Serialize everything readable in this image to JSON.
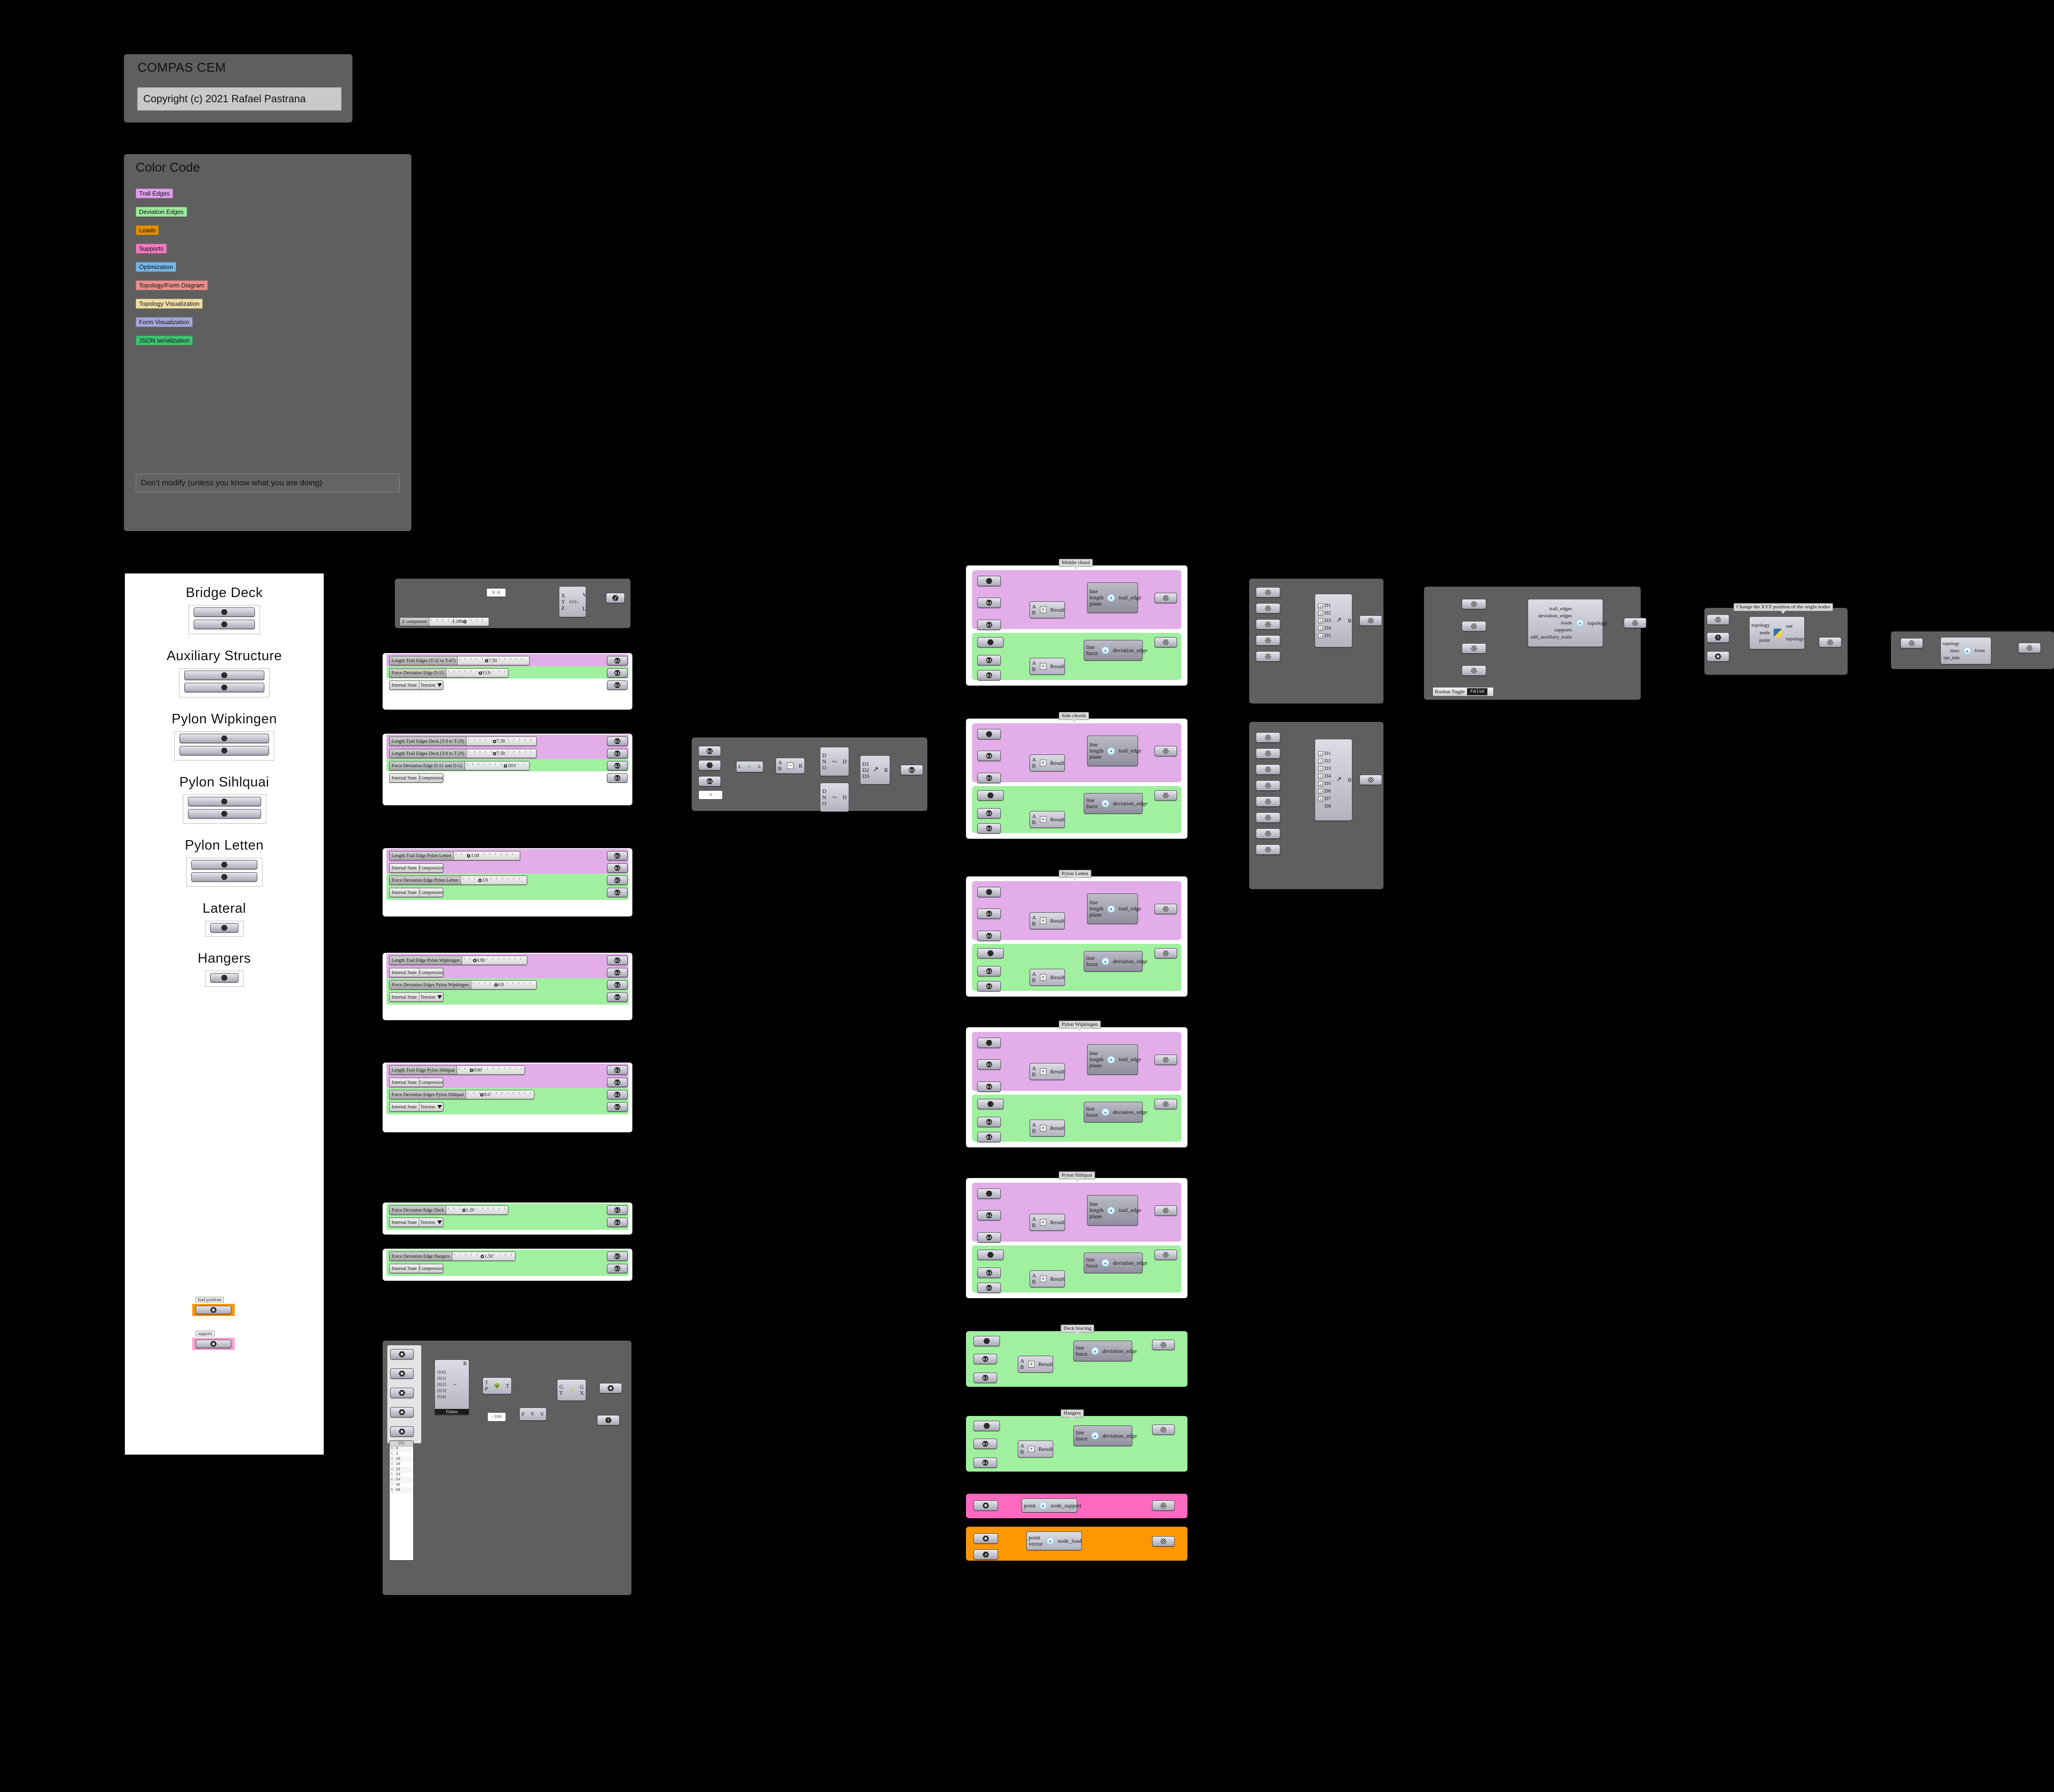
{
  "header": {
    "title": "COMPAS CEM",
    "copyright": "Copyright (c) 2021 Rafael Pastrana"
  },
  "color_code": {
    "title": "Color Code",
    "note": "Don’t modify (unless you know what you are doing)",
    "items": [
      {
        "label": "Trail Edges",
        "color": "#dda0e8"
      },
      {
        "label": "Deviation Edges",
        "color": "#9ce89c"
      },
      {
        "label": "Loads",
        "color": "#e09000"
      },
      {
        "label": "Supports",
        "color": "#f07ac0"
      },
      {
        "label": "Optimization",
        "color": "#74b6e8"
      },
      {
        "label": "Topology/Form Diagram",
        "color": "#e8908c"
      },
      {
        "label": "Topology Visualization",
        "color": "#eedfa5"
      },
      {
        "label": "Form Visualization",
        "color": "#a5a5d8"
      },
      {
        "label": "JSON serialization",
        "color": "#40c070"
      }
    ]
  },
  "structure_panel": {
    "sections": [
      {
        "title": "Bridge Deck",
        "params": 2
      },
      {
        "title": "Auxiliary Structure",
        "params": 2
      },
      {
        "title": "Pylon Wipkingen",
        "params": 2
      },
      {
        "title": "Pylon Sihlquai",
        "params": 2
      },
      {
        "title": "Pylon Letten",
        "params": 2
      },
      {
        "title": "Lateral",
        "params": 1
      },
      {
        "title": "Hangers",
        "params": 1
      }
    ],
    "tagged": [
      {
        "label": "load positions",
        "color": "#ff9800"
      },
      {
        "label": "supports",
        "color": "#ff9fd4"
      }
    ]
  },
  "vector_cluster": {
    "panel_value": "0.0",
    "slider": {
      "name": "Z component",
      "value": "-1.500"
    },
    "component": {
      "inputs": [
        "X",
        "Y",
        "Z"
      ],
      "outputs": [
        "V",
        "L"
      ],
      "icon": "xyz-vector-icon"
    }
  },
  "slider_groups": [
    {
      "rows": [
        {
          "band": "purple",
          "type": "slider",
          "name": "Length Trail Edges  (T-32 to T-47)",
          "value": "7.50",
          "knob": 0.42
        },
        {
          "band": "green",
          "type": "slider",
          "name": "Force Deviation Edge D-53",
          "value": "15.0",
          "knob": 0.72
        },
        {
          "band": "none",
          "type": "vlist",
          "name": "Internal State",
          "value": "Tension"
        }
      ]
    },
    {
      "rows": [
        {
          "band": "purple",
          "type": "slider",
          "name": "Length Trail Edges Deck (T-0 to T-29)",
          "value": "7.50",
          "knob": 0.42
        },
        {
          "band": "purple",
          "type": "slider",
          "name": "Length Trail Edges Deck (T-0 to T-29)",
          "value": "7.50",
          "knob": 0.42
        },
        {
          "band": "green",
          "type": "slider",
          "name": "Force Deviation Edge D-51 and D-52",
          "value": "20.0",
          "knob": 0.88
        },
        {
          "band": "none",
          "type": "vlist",
          "name": "Internal State",
          "value": "Compression"
        }
      ]
    },
    {
      "rows": [
        {
          "band": "purple",
          "type": "slider",
          "name": "Length Trail Edge Pylon Letten",
          "value": "1.00",
          "knob": 0.08
        },
        {
          "band": "purple",
          "type": "vlist",
          "name": "Internal State",
          "value": "Compression"
        },
        {
          "band": "green",
          "type": "slider",
          "name": "Force Deviation Edge Pylon Letten",
          "value": "3.0",
          "knob": 0.17
        },
        {
          "band": "green",
          "type": "vlist",
          "name": "Internal State",
          "value": "Compression"
        }
      ]
    },
    {
      "rows": [
        {
          "band": "purple",
          "type": "slider",
          "name": "Length Trail Edge Pylon Wipkingen",
          "value": "0.00",
          "knob": 0.02
        },
        {
          "band": "purple",
          "type": "vlist",
          "name": "Internal State",
          "value": "Compression"
        },
        {
          "band": "green",
          "type": "slider",
          "name": "Force Deviation Edges Pylon Wipkingen",
          "value": "0.0",
          "knob": 0.35
        },
        {
          "band": "green",
          "type": "vlist",
          "name": "Internal State",
          "value": "Tension"
        }
      ]
    },
    {
      "rows": [
        {
          "band": "purple",
          "type": "slider",
          "name": "Length Trail Edge Pylon Sihlquai",
          "value": "0.00",
          "knob": 0.03
        },
        {
          "band": "purple",
          "type": "vlist",
          "name": "Internal State",
          "value": "Compression"
        },
        {
          "band": "green",
          "type": "slider",
          "name": "Force Deviation Edges Pylon Sihlquai",
          "value": "0.0",
          "knob": 0.04
        },
        {
          "band": "green",
          "type": "vlist",
          "name": "Internal State",
          "value": "Tension"
        }
      ]
    },
    {
      "rows": [
        {
          "band": "green",
          "type": "slider",
          "name": "Force Deviation Edge Deck",
          "value": "1.20",
          "knob": 0.22
        },
        {
          "band": "green",
          "type": "vlist",
          "name": "Internal State",
          "value": "Tension"
        }
      ]
    },
    {
      "rows": [
        {
          "band": "green",
          "type": "slider",
          "name": "Force Deviation Edge Hangers",
          "value": "1.30",
          "knob": 0.59
        },
        {
          "band": "green",
          "type": "vlist",
          "name": "Internal State",
          "value": "Compression"
        }
      ]
    }
  ],
  "edge_clusters": [
    {
      "label": "Middle chord",
      "trail": {
        "icon": "cem-icon",
        "inputs": [
          "line",
          "length",
          "plane"
        ],
        "output": "trail_edge"
      },
      "deviation": {
        "icon": "cem-icon",
        "inputs": [
          "line",
          "force"
        ],
        "output": "deviation_edge"
      },
      "math": {
        "a": "A",
        "b": "B",
        "op": "×",
        "result": "Result"
      }
    },
    {
      "label": "Side chords",
      "trail": {
        "icon": "cem-icon",
        "inputs": [
          "line",
          "length",
          "plane"
        ],
        "output": "trail_edge"
      },
      "deviation": {
        "icon": "cem-icon",
        "inputs": [
          "line",
          "force"
        ],
        "output": "deviation_edge"
      },
      "math": {
        "a": "A",
        "b": "B",
        "op": "×",
        "result": "Result"
      }
    },
    {
      "label": "Pylon Letten",
      "trail": {
        "icon": "cem-icon",
        "inputs": [
          "line",
          "length",
          "plane"
        ],
        "output": "trail_edge"
      },
      "deviation": {
        "icon": "cem-icon",
        "inputs": [
          "line",
          "force"
        ],
        "output": "deviation_edge"
      },
      "math": {
        "a": "A",
        "b": "B",
        "op": "×",
        "result": "Result"
      }
    },
    {
      "label": "Pylon Wipkingen",
      "trail": {
        "icon": "cem-icon",
        "inputs": [
          "line",
          "length",
          "plane"
        ],
        "output": "trail_edge"
      },
      "deviation": {
        "icon": "cem-icon",
        "inputs": [
          "line",
          "force"
        ],
        "output": "deviation_edge"
      },
      "math": {
        "a": "A",
        "b": "B",
        "op": "×",
        "result": "Result"
      }
    },
    {
      "label": "Pylon Sihlquai",
      "trail": {
        "icon": "cem-icon",
        "inputs": [
          "line",
          "length",
          "plane"
        ],
        "output": "trail_edge"
      },
      "deviation": {
        "icon": "cem-icon",
        "inputs": [
          "line",
          "force"
        ],
        "output": "deviation_edge"
      },
      "math": {
        "a": "A",
        "b": "B",
        "op": "×",
        "result": "Result"
      }
    }
  ],
  "deck_bracing": {
    "label": "Deck bracing",
    "deviation": {
      "inputs": [
        "line",
        "force"
      ],
      "output": "deviation_edge"
    },
    "math": {
      "a": "A",
      "b": "B",
      "op": "×",
      "result": "Result"
    }
  },
  "hangers": {
    "label": "Hangers",
    "deviation": {
      "inputs": [
        "line",
        "force"
      ],
      "output": "deviation_edge"
    },
    "math": {
      "a": "A",
      "b": "B",
      "op": "×",
      "result": "Result"
    }
  },
  "supports_cluster": {
    "component": {
      "inputs": [
        "point"
      ],
      "output": "node_support"
    }
  },
  "loads_cluster": {
    "component": {
      "inputs": [
        "point",
        "vector"
      ],
      "output": "node_load"
    }
  },
  "merge_top": {
    "inputs": [
      "D1",
      "D2",
      "D3",
      "D4",
      "D5"
    ],
    "output": "R"
  },
  "merge_bottom": {
    "inputs": [
      "D1",
      "D2",
      "D3",
      "D4",
      "D5",
      "D6",
      "D7",
      "D8"
    ],
    "output": "R"
  },
  "topology_cluster": {
    "component": {
      "inputs": [
        "trail_edges",
        "deviation_edges",
        "loads",
        "supports",
        "add_auxiliary_trails"
      ],
      "output": "topology"
    },
    "toggle": {
      "name": "Boolean Toggle",
      "value": "False"
    }
  },
  "python_cluster": {
    "label": "Change the XYZ position of the origin nodes",
    "component": {
      "inputs": [
        "topology",
        "node",
        "point"
      ],
      "outputs": [
        "out",
        "topology"
      ],
      "icon": "python-icon"
    },
    "count_param": "7"
  },
  "form_cluster": {
    "component": {
      "inputs": [
        "topology",
        "tmax",
        "eps_min"
      ],
      "output": "form"
    }
  },
  "list_cluster": {
    "panel_value": "4",
    "divide": {
      "inputs": [
        "D",
        "N",
        "O"
      ],
      "output": "D"
    },
    "minus": {
      "a": "A",
      "b": "B",
      "op": "−",
      "result": "R"
    },
    "length": {
      "input": "L",
      "output": "L"
    },
    "merge": {
      "inputs": [
        "D1",
        "D2",
        "D3"
      ],
      "output": "R"
    }
  },
  "bottom_cluster": {
    "tree": {
      "branches": [
        "{0;0}",
        "{0;1}",
        "{0;2}",
        "{0;3}",
        "{0;4}"
      ],
      "output": "R",
      "footer": "Flatten"
    },
    "tree_node": {
      "inputs": [
        "T",
        "P"
      ],
      "output": "T"
    },
    "move_panel": "-350",
    "unit_y": {
      "input": "F",
      "label": "Y",
      "output": "V"
    },
    "transform": {
      "inputs": [
        "G",
        "T"
      ],
      "outputs": [
        "G",
        "X"
      ]
    },
    "count_param": "7",
    "index_panel": {
      "header": "{0}",
      "values": [
        "0",
        "2",
        "18",
        "20",
        "22",
        "24",
        "54",
        "56",
        "58"
      ]
    }
  }
}
